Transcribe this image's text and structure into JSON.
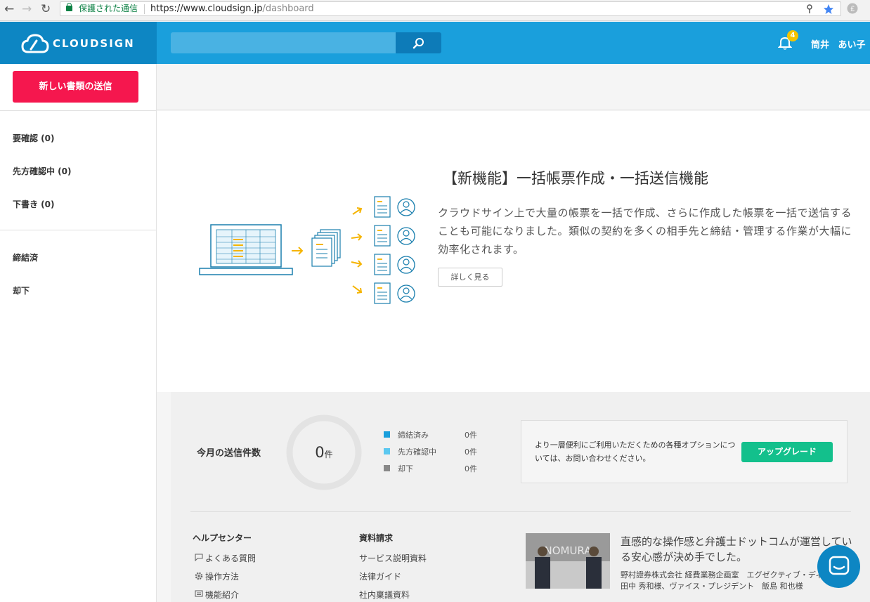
{
  "browser": {
    "secure_label": "保護された通信",
    "url_host": "https://www.cloudsign.jp",
    "url_path": "/dashboard"
  },
  "header": {
    "logo_text": "CLOUDSIGN",
    "search_placeholder": "",
    "notification_count": "4",
    "user_name": "筒井 あい子"
  },
  "sidebar": {
    "new_document_button": "新しい書類の送信",
    "items": [
      {
        "label": "要確認 (0)"
      },
      {
        "label": "先方確認中 (0)"
      },
      {
        "label": "下書き (0)"
      },
      {
        "label": "締結済"
      },
      {
        "label": "却下"
      }
    ]
  },
  "feature": {
    "title": "【新機能】一括帳票作成・一括送信機能",
    "body": "クラウドサイン上で大量の帳票を一括で作成、さらに作成した帳票を一括で送信することも可能になりました。類似の契約を多くの相手先と締結・管理する作業が大幅に効率化されます。",
    "more_button": "詳しく見る"
  },
  "stats": {
    "label": "今月の送信件数",
    "total": "0",
    "total_unit": "件",
    "legend": [
      {
        "name": "締結済み",
        "count": "0件",
        "color": "#1a9fdc"
      },
      {
        "name": "先方確認中",
        "count": "0件",
        "color": "#5bc8f0"
      },
      {
        "name": "却下",
        "count": "0件",
        "color": "#888888"
      }
    ]
  },
  "upgrade": {
    "text": "より一層便利にご利用いただくための各種オプションについては、お問い合わせください。",
    "button": "アップグレード"
  },
  "footer": {
    "help_title": "ヘルプセンター",
    "help_links": [
      "よくある質問",
      "操作方法",
      "機能紹介"
    ],
    "docs_title": "資料請求",
    "docs_links": [
      "サービス説明資料",
      "法律ガイド",
      "社内稟議資料"
    ],
    "case_image_text": "NOMURA",
    "case_title": "直感的な操作感と弁護士ドットコムが運営している安心感が決め手でした。",
    "case_body": "野村證券株式会社 経費業務企画室　エグゼクティブ・ディレクター　田中 秀和様、ヴァイス・プレジデント　飯島 和也様"
  },
  "colors": {
    "header": "#1a9fdc",
    "logo_bg": "#0d86c3",
    "new_doc": "#f5174e",
    "upgrade": "#13c08c",
    "accent_yellow": "#f5c400"
  }
}
